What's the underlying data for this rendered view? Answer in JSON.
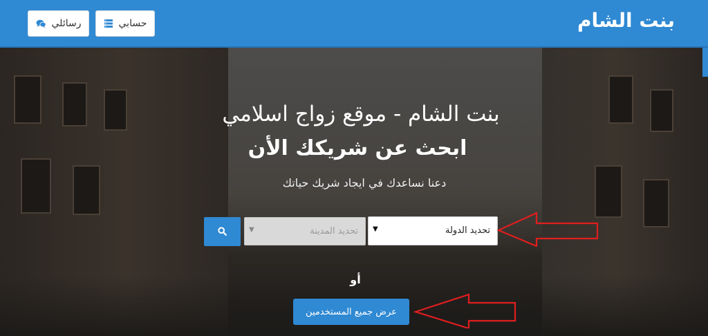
{
  "header": {
    "brand": "بنت الشام",
    "account_label": "حسابي",
    "messages_label": "رسائلي",
    "color": "#2f89d3"
  },
  "icons": {
    "account": "server-list-icon",
    "messages": "chat-bubbles-icon",
    "search": "search-icon",
    "caret": "caret-down-icon"
  },
  "hero": {
    "title": "بنت الشام - موقع زواج اسلامي",
    "headline": "ابحث عن شريكك الأن",
    "subtitle": "دعنا نساعدك في ايجاد شريك حياتك",
    "country_select": {
      "selected": "تحديد الدولة"
    },
    "city_select": {
      "selected": "تحديد المدينة",
      "disabled": true
    },
    "or_text": "أو",
    "all_users_button": "عرض جميع المستخدمين"
  },
  "annotations": {
    "arrow_color": "#e01e1e",
    "arrows": [
      "arrow-to-country-select",
      "arrow-to-all-users-button"
    ]
  }
}
